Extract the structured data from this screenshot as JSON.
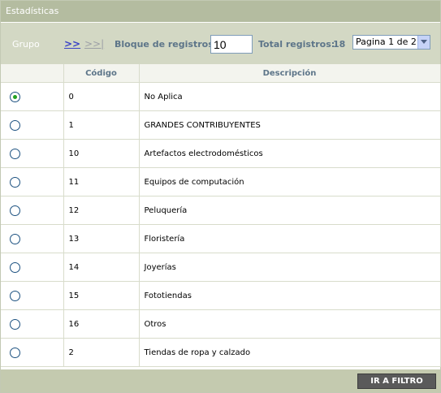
{
  "window": {
    "title": "Estadísticas"
  },
  "toolbar": {
    "group_label": "Grupo",
    "next_link": ">>",
    "last_link": ">>|",
    "block_label": "Bloque de registros:",
    "block_value": "10",
    "total_label": "Total registros:",
    "total_value": "18",
    "page_select": "Pagina 1 de 2"
  },
  "table": {
    "columns": [
      "",
      "Código",
      "Descripción"
    ],
    "rows": [
      {
        "codigo": "0",
        "descripcion": "No Aplica",
        "selected": true
      },
      {
        "codigo": "1",
        "descripcion": "GRANDES CONTRIBUYENTES",
        "selected": false
      },
      {
        "codigo": "10",
        "descripcion": "Artefactos electrodomésticos",
        "selected": false
      },
      {
        "codigo": "11",
        "descripcion": "Equipos de computación",
        "selected": false
      },
      {
        "codigo": "12",
        "descripcion": "Peluquería",
        "selected": false
      },
      {
        "codigo": "13",
        "descripcion": "Floristería",
        "selected": false
      },
      {
        "codigo": "14",
        "descripcion": "Joyerías",
        "selected": false
      },
      {
        "codigo": "15",
        "descripcion": "Fototiendas",
        "selected": false
      },
      {
        "codigo": "16",
        "descripcion": "Otros",
        "selected": false
      },
      {
        "codigo": "2",
        "descripcion": "Tiendas de ropa y calzado",
        "selected": false
      }
    ]
  },
  "footer": {
    "filter_button": "IR A FILTRO"
  },
  "colors": {
    "header_bg": "#b4bca0",
    "toolbar_bg": "#d3d8c4",
    "label_text": "#5d7589",
    "button_bg": "#5a5a5a"
  }
}
